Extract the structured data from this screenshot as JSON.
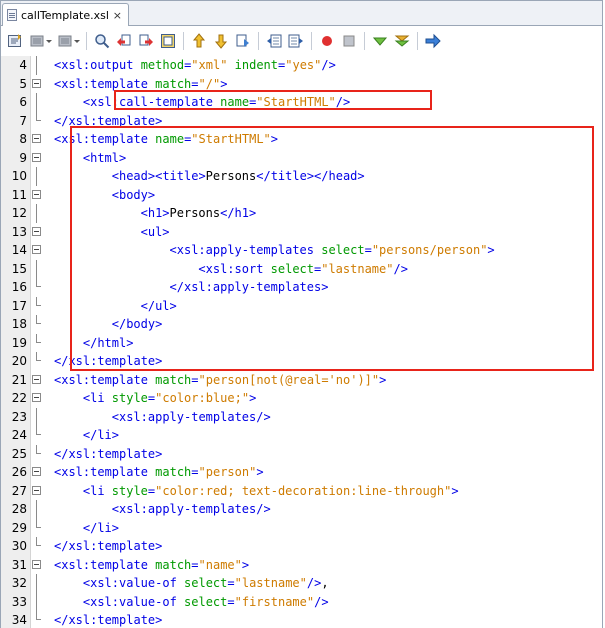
{
  "tab": {
    "title": "callTemplate.xsl",
    "close": "×"
  },
  "toolbar": {
    "icons": [
      "source-history-icon",
      "back-icon",
      "dropdown-icon",
      "forward-icon",
      "dropdown-icon",
      "find-icon",
      "find-prev-icon",
      "find-next-icon",
      "toggle-highlight-icon",
      "prev-bookmark-icon",
      "next-bookmark-icon",
      "toggle-bookmark-icon",
      "shift-left-icon",
      "shift-right-icon",
      "record-macro-icon",
      "stop-macro-icon",
      "validate-xml-icon",
      "check-xml-icon",
      "run-xsl-icon"
    ]
  },
  "lines": [
    {
      "n": "4",
      "fold": "line",
      "indent": 2,
      "tokens": [
        [
          "t",
          "<xsl:output "
        ],
        [
          "a",
          "method"
        ],
        [
          "t",
          "="
        ],
        [
          "v",
          "\"xml\""
        ],
        [
          "t",
          " "
        ],
        [
          "a",
          "indent"
        ],
        [
          "t",
          "="
        ],
        [
          "v",
          "\"yes\""
        ],
        [
          "t",
          "/>"
        ]
      ]
    },
    {
      "n": "5",
      "fold": "open",
      "indent": 2,
      "tokens": [
        [
          "t",
          "<xsl:template "
        ],
        [
          "a",
          "match"
        ],
        [
          "t",
          "="
        ],
        [
          "v",
          "\"/\""
        ],
        [
          "t",
          ">"
        ]
      ]
    },
    {
      "n": "6",
      "fold": "line",
      "indent": 4,
      "tokens": [
        [
          "t",
          "<xsl:call-template "
        ],
        [
          "a",
          "name"
        ],
        [
          "t",
          "="
        ],
        [
          "v",
          "\"StartHTML\""
        ],
        [
          "t",
          "/>"
        ]
      ]
    },
    {
      "n": "7",
      "fold": "end",
      "indent": 2,
      "tokens": [
        [
          "t",
          "</xsl:template>"
        ]
      ]
    },
    {
      "n": "8",
      "fold": "open",
      "indent": 2,
      "tokens": [
        [
          "t",
          "<xsl:template "
        ],
        [
          "a",
          "name"
        ],
        [
          "t",
          "="
        ],
        [
          "v",
          "\"StartHTML\""
        ],
        [
          "t",
          ">"
        ]
      ]
    },
    {
      "n": "9",
      "fold": "open",
      "indent": 4,
      "tokens": [
        [
          "t",
          "<html>"
        ]
      ]
    },
    {
      "n": "10",
      "fold": "line",
      "indent": 6,
      "tokens": [
        [
          "t",
          "<head><title>"
        ],
        [
          "x",
          "Persons"
        ],
        [
          "t",
          "</title></head>"
        ]
      ]
    },
    {
      "n": "11",
      "fold": "open",
      "indent": 6,
      "tokens": [
        [
          "t",
          "<body>"
        ]
      ]
    },
    {
      "n": "12",
      "fold": "line",
      "indent": 8,
      "tokens": [
        [
          "t",
          "<h1>"
        ],
        [
          "x",
          "Persons"
        ],
        [
          "t",
          "</h1>"
        ]
      ]
    },
    {
      "n": "13",
      "fold": "open",
      "indent": 8,
      "tokens": [
        [
          "t",
          "<ul>"
        ]
      ]
    },
    {
      "n": "14",
      "fold": "open",
      "indent": 10,
      "tokens": [
        [
          "t",
          "<xsl:apply-templates "
        ],
        [
          "a",
          "select"
        ],
        [
          "t",
          "="
        ],
        [
          "v",
          "\"persons/person\""
        ],
        [
          "t",
          ">"
        ]
      ]
    },
    {
      "n": "15",
      "fold": "line",
      "indent": 12,
      "tokens": [
        [
          "t",
          "<xsl:sort "
        ],
        [
          "a",
          "select"
        ],
        [
          "t",
          "="
        ],
        [
          "v",
          "\"lastname\""
        ],
        [
          "t",
          "/>"
        ]
      ]
    },
    {
      "n": "16",
      "fold": "end",
      "indent": 10,
      "tokens": [
        [
          "t",
          "</xsl:apply-templates>"
        ]
      ]
    },
    {
      "n": "17",
      "fold": "end",
      "indent": 8,
      "tokens": [
        [
          "t",
          "</ul>"
        ]
      ]
    },
    {
      "n": "18",
      "fold": "end",
      "indent": 6,
      "tokens": [
        [
          "t",
          "</body>"
        ]
      ]
    },
    {
      "n": "19",
      "fold": "end",
      "indent": 4,
      "tokens": [
        [
          "t",
          "</html>"
        ]
      ]
    },
    {
      "n": "20",
      "fold": "end",
      "indent": 2,
      "tokens": [
        [
          "t",
          "</xsl:template>"
        ]
      ]
    },
    {
      "n": "21",
      "fold": "open",
      "indent": 2,
      "tokens": [
        [
          "t",
          "<xsl:template "
        ],
        [
          "a",
          "match"
        ],
        [
          "t",
          "="
        ],
        [
          "v",
          "\"person[not(@real='no')]\""
        ],
        [
          "t",
          ">"
        ]
      ]
    },
    {
      "n": "22",
      "fold": "open",
      "indent": 4,
      "tokens": [
        [
          "t",
          "<li "
        ],
        [
          "a",
          "style"
        ],
        [
          "t",
          "="
        ],
        [
          "v",
          "\"color:blue;\""
        ],
        [
          "t",
          ">"
        ]
      ]
    },
    {
      "n": "23",
      "fold": "line",
      "indent": 6,
      "tokens": [
        [
          "t",
          "<xsl:apply-templates/>"
        ]
      ]
    },
    {
      "n": "24",
      "fold": "end",
      "indent": 4,
      "tokens": [
        [
          "t",
          "</li>"
        ]
      ]
    },
    {
      "n": "25",
      "fold": "end",
      "indent": 2,
      "tokens": [
        [
          "t",
          "</xsl:template>"
        ]
      ]
    },
    {
      "n": "26",
      "fold": "open",
      "indent": 2,
      "tokens": [
        [
          "t",
          "<xsl:template "
        ],
        [
          "a",
          "match"
        ],
        [
          "t",
          "="
        ],
        [
          "v",
          "\"person\""
        ],
        [
          "t",
          ">"
        ]
      ]
    },
    {
      "n": "27",
      "fold": "open",
      "indent": 4,
      "tokens": [
        [
          "t",
          "<li "
        ],
        [
          "a",
          "style"
        ],
        [
          "t",
          "="
        ],
        [
          "v",
          "\"color:red; text-decoration:line-through\""
        ],
        [
          "t",
          ">"
        ]
      ]
    },
    {
      "n": "28",
      "fold": "line",
      "indent": 6,
      "tokens": [
        [
          "t",
          "<xsl:apply-templates/>"
        ]
      ]
    },
    {
      "n": "29",
      "fold": "end",
      "indent": 4,
      "tokens": [
        [
          "t",
          "</li>"
        ]
      ]
    },
    {
      "n": "30",
      "fold": "end",
      "indent": 2,
      "tokens": [
        [
          "t",
          "</xsl:template>"
        ]
      ]
    },
    {
      "n": "31",
      "fold": "open",
      "indent": 2,
      "tokens": [
        [
          "t",
          "<xsl:template "
        ],
        [
          "a",
          "match"
        ],
        [
          "t",
          "="
        ],
        [
          "v",
          "\"name\""
        ],
        [
          "t",
          ">"
        ]
      ]
    },
    {
      "n": "32",
      "fold": "line",
      "indent": 4,
      "tokens": [
        [
          "t",
          "<xsl:value-of "
        ],
        [
          "a",
          "select"
        ],
        [
          "t",
          "="
        ],
        [
          "v",
          "\"lastname\""
        ],
        [
          "t",
          "/>"
        ],
        [
          "x",
          ","
        ]
      ]
    },
    {
      "n": "33",
      "fold": "line",
      "indent": 4,
      "tokens": [
        [
          "t",
          "<xsl:value-of "
        ],
        [
          "a",
          "select"
        ],
        [
          "t",
          "="
        ],
        [
          "v",
          "\"firstname\""
        ],
        [
          "t",
          "/>"
        ]
      ]
    },
    {
      "n": "34",
      "fold": "end",
      "indent": 2,
      "tokens": [
        [
          "t",
          "</xsl:template>"
        ]
      ]
    }
  ],
  "colors": {
    "tag": "#0000e6",
    "attribute": "#009900",
    "value": "#ce7b00",
    "highlight_box": "#e8241a"
  }
}
